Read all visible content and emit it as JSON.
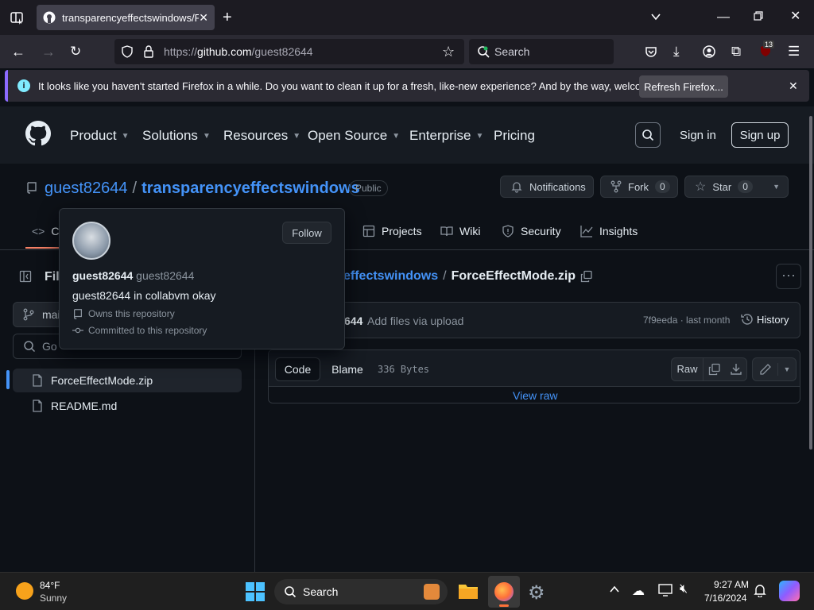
{
  "browser": {
    "tab_title": "transparencyeffectswindows/Fo",
    "url_prefix": "https://",
    "url_host": "github.com",
    "url_path": "/guest82644",
    "search_placeholder": "Search",
    "ext_badge": "13",
    "notification_text": "It looks like you haven't started Firefox in a while. Do you want to clean it up for a fresh, like-new experience? And by the way, welcome back!",
    "refresh_label": "Refresh Firefox..."
  },
  "gh_header": {
    "nav": [
      "Product",
      "Solutions",
      "Resources",
      "Open Source",
      "Enterprise",
      "Pricing"
    ],
    "signin": "Sign in",
    "signup": "Sign up"
  },
  "repo": {
    "owner": "guest82644",
    "separator": "/",
    "name": "transparencyeffectswindows",
    "visibility": "Public",
    "notifications_label": "Notifications",
    "fork_label": "Fork",
    "fork_count": "0",
    "star_label": "Star",
    "star_count": "0",
    "tabs": {
      "code": "C",
      "projects": "Projects",
      "wiki": "Wiki",
      "security": "Security",
      "insights": "Insights"
    }
  },
  "sidebar": {
    "title": "File",
    "branch": "mai",
    "goto_placeholder": "Go",
    "files": [
      "ForceEffectMode.zip",
      "README.md"
    ]
  },
  "file": {
    "breadcrumb_repo": "effectswindows",
    "breadcrumb_sep": "/",
    "breadcrumb_file": "ForceEffectMode.zip",
    "commit_author": "644",
    "commit_message": "Add files via upload",
    "commit_meta": "7f9eeda · last month",
    "history_label": "History",
    "code_tab": "Code",
    "blame_tab": "Blame",
    "size": "336 Bytes",
    "raw_label": "Raw",
    "view_raw": "View raw"
  },
  "popover": {
    "follow": "Follow",
    "name": "guest82644",
    "login": "guest82644",
    "bio": "guest82644 in collabvm okay",
    "owns": "Owns this repository",
    "committed": "Committed to this repository"
  },
  "taskbar": {
    "weather_temp": "84°F",
    "weather_desc": "Sunny",
    "search_label": "Search",
    "time": "9:27 AM",
    "date": "7/16/2024"
  },
  "colors": {
    "accent": "#4493f8",
    "bg": "#0d1117",
    "firefox_notice": "#8c6bff"
  }
}
